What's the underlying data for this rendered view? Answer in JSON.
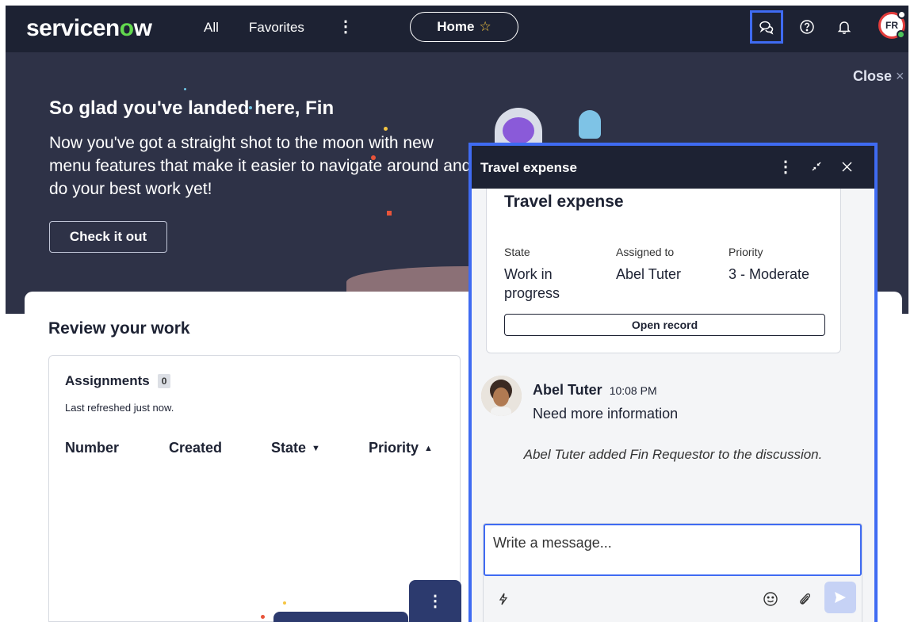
{
  "topnav": {
    "brand_prefix": "servicen",
    "brand_o": "o",
    "brand_suffix": "w",
    "all_label": "All",
    "favorites_label": "Favorites",
    "more_label": "⋮",
    "home_label": "Home",
    "home_star": "☆",
    "avatar_initials": "FR",
    "icons": [
      "chat-icon",
      "help-icon",
      "bell-icon"
    ]
  },
  "hero": {
    "close_label": "Close",
    "close_glyph": "×",
    "title": "So glad you've landed here, Fin",
    "text": "Now you've got a straight shot to the moon with new menu features that make it easier to navigate around and do your best work yet!",
    "cta_label": "Check it out"
  },
  "review": {
    "title": "Review your work",
    "assignments_label": "Assignments",
    "assignments_count": "0",
    "refreshed_text": "Last refreshed just now.",
    "columns": [
      {
        "label": "Number",
        "sort": ""
      },
      {
        "label": "Created",
        "sort": ""
      },
      {
        "label": "State",
        "sort": "▼"
      },
      {
        "label": "Priority",
        "sort": "▲"
      }
    ],
    "fab_label": "⋮"
  },
  "conversation": {
    "title": "Travel expense",
    "more_glyph": "⋮",
    "record": {
      "title": "Travel expense",
      "state_label": "State",
      "state_value": "Work in progress",
      "assigned_label": "Assigned to",
      "assigned_value": "Abel Tuter",
      "priority_label": "Priority",
      "priority_value": "3 - Moderate",
      "open_label": "Open record"
    },
    "message": {
      "author": "Abel Tuter",
      "time": "10:08 PM",
      "body": "Need more information"
    },
    "system_message": "Abel Tuter added Fin Requestor to the discussion.",
    "composer": {
      "placeholder": "Write a message..."
    }
  },
  "colors": {
    "nav_bg": "#1d2233",
    "hero_bg": "#2e3247",
    "accent_blue": "#3f6bf2",
    "brand_green": "#62d84e",
    "send_disabled": "#c6d2f5"
  }
}
